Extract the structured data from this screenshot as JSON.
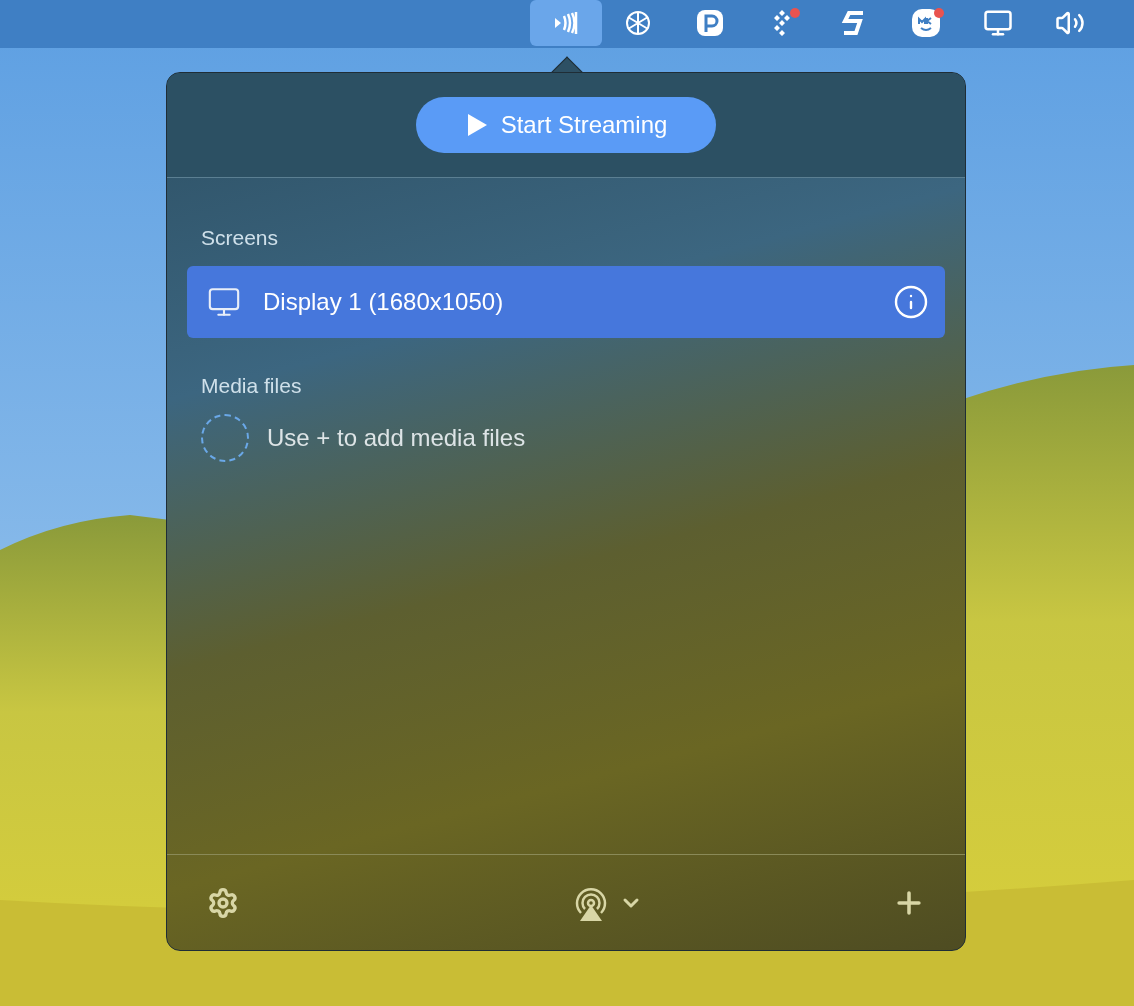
{
  "menu_bar": {
    "items": [
      {
        "selected": true,
        "notification": false
      },
      {
        "selected": false,
        "notification": false
      },
      {
        "selected": false,
        "notification": false
      },
      {
        "selected": false,
        "notification": true
      },
      {
        "selected": false,
        "notification": false
      },
      {
        "selected": false,
        "notification": true
      },
      {
        "selected": false,
        "notification": false
      },
      {
        "selected": false,
        "notification": false
      }
    ]
  },
  "popover": {
    "start_button": "Start Streaming",
    "sections": [
      {
        "title": "Screens",
        "kind": "list",
        "items": [
          {
            "label": "Display 1 (1680x1050)",
            "selected": true
          }
        ]
      },
      {
        "title": "Media files",
        "kind": "empty",
        "placeholder": "Use + to add media files"
      }
    ]
  }
}
